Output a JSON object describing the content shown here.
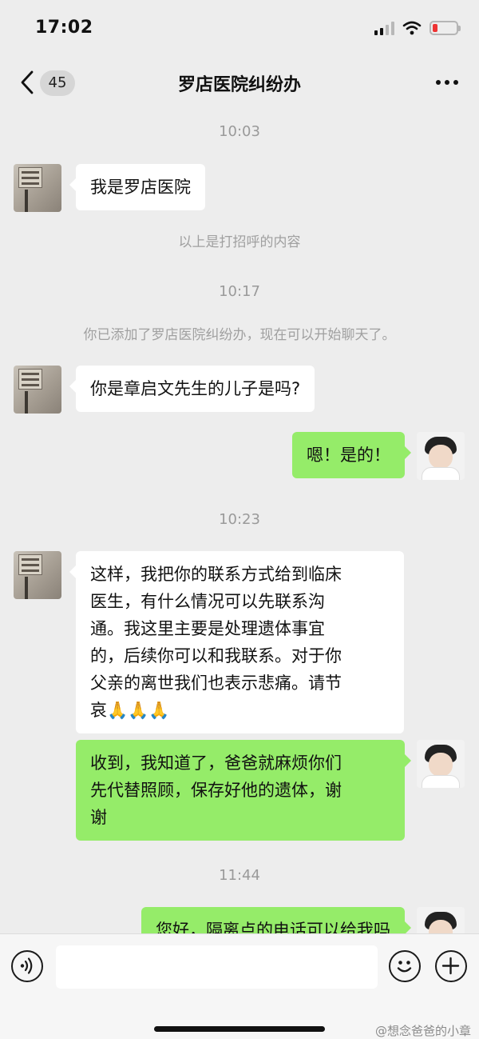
{
  "status_bar": {
    "time": "17:02"
  },
  "nav": {
    "unread_count": "45",
    "title": "罗店医院纠纷办"
  },
  "messages": [
    {
      "type": "timestamp",
      "text": "10:03"
    },
    {
      "type": "in",
      "text": "我是罗店医院"
    },
    {
      "type": "system",
      "text": "以上是打招呼的内容"
    },
    {
      "type": "timestamp",
      "text": "10:17"
    },
    {
      "type": "system",
      "text": "你已添加了罗店医院纠纷办，现在可以开始聊天了。"
    },
    {
      "type": "in",
      "text": "你是章启文先生的儿子是吗?"
    },
    {
      "type": "out",
      "text": "嗯！是的！"
    },
    {
      "type": "timestamp",
      "text": "10:23"
    },
    {
      "type": "in",
      "lines": [
        "这样，我把你的联系方式给到临床",
        "医生，有什么情况可以先联系沟",
        "通。我这里主要是处理遗体事宜",
        "的，后续你可以和我联系。对于你",
        "父亲的离世我们也表示悲痛。请节",
        "哀🙏🙏🙏"
      ]
    },
    {
      "type": "out",
      "lines": [
        "收到，我知道了，爸爸就麻烦你们",
        "先代替照顾，保存好他的遗体，谢",
        "谢"
      ]
    },
    {
      "type": "timestamp",
      "text": "11:44"
    },
    {
      "type": "out",
      "text": "您好，隔离点的电话可以给我吗"
    }
  ],
  "input": {
    "placeholder": ""
  },
  "watermark": "@想念爸爸的小章",
  "colors": {
    "background": "#ededed",
    "outgoing_bubble": "#95ec69",
    "incoming_bubble": "#ffffff",
    "battery_low": "#ee3333"
  },
  "icons": [
    "back-chevron-icon",
    "more-dots-icon",
    "voice-icon",
    "emoji-icon",
    "plus-icon",
    "signal-icon",
    "wifi-icon",
    "battery-icon"
  ]
}
